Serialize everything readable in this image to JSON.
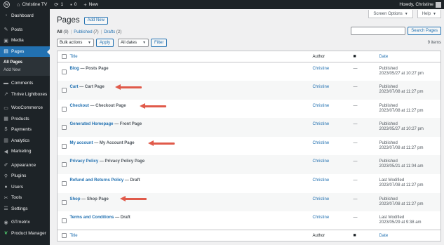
{
  "admin_bar": {
    "site_name": "Christine TV",
    "updates_count": "1",
    "comments_count": "0",
    "new_label": "New",
    "howdy": "Howdy, Christine"
  },
  "sidebar": {
    "items": [
      {
        "label": "Dashboard",
        "icon": "dashboard-icon"
      },
      {
        "label": "Posts",
        "icon": "pin-icon"
      },
      {
        "label": "Media",
        "icon": "media-icon"
      },
      {
        "label": "Pages",
        "icon": "page-icon"
      },
      {
        "label": "Comments",
        "icon": "comment-icon"
      },
      {
        "label": "Thrive Lightboxes",
        "icon": "thrive-icon"
      },
      {
        "label": "WooCommerce",
        "icon": "woo-icon"
      },
      {
        "label": "Products",
        "icon": "products-icon"
      },
      {
        "label": "Payments",
        "icon": "payments-icon"
      },
      {
        "label": "Analytics",
        "icon": "analytics-icon"
      },
      {
        "label": "Marketing",
        "icon": "megaphone-icon"
      },
      {
        "label": "Appearance",
        "icon": "brush-icon"
      },
      {
        "label": "Plugins",
        "icon": "plugin-icon"
      },
      {
        "label": "Users",
        "icon": "users-icon"
      },
      {
        "label": "Tools",
        "icon": "wrench-icon"
      },
      {
        "label": "Settings",
        "icon": "settings-icon"
      },
      {
        "label": "GTmetrix",
        "icon": "gtmetrix-icon"
      },
      {
        "label": "Product Manager",
        "icon": "leaf-icon"
      }
    ],
    "submenu": [
      "All Pages",
      "Add New"
    ]
  },
  "screen_options_label": "Screen Options",
  "help_label": "Help",
  "page_title": "Pages",
  "add_new_label": "Add New",
  "filters": {
    "all_label": "All",
    "all_count": "(9)",
    "published_label": "Published",
    "published_count": "(7)",
    "drafts_label": "Drafts",
    "drafts_count": "(2)"
  },
  "search": {
    "button_label": "Search Pages",
    "value": ""
  },
  "tablenav": {
    "bulk_actions": "Bulk actions",
    "apply_label": "Apply",
    "all_dates": "All dates",
    "filter_label": "Filter",
    "items_count": "9 items"
  },
  "table": {
    "headers": {
      "title": "Title",
      "author": "Author",
      "date": "Date"
    },
    "rows": [
      {
        "title": "Blog",
        "state": "— Posts Page",
        "author": "Christine",
        "comments": "—",
        "status": "Published",
        "date": "2023/05/27 at 10:27 pm"
      },
      {
        "title": "Cart",
        "state": "— Cart Page",
        "author": "Christine",
        "comments": "—",
        "status": "Published",
        "date": "2023/07/08 at 11:27 pm"
      },
      {
        "title": "Checkout",
        "state": "— Checkout Page",
        "author": "Christine",
        "comments": "—",
        "status": "Published",
        "date": "2023/07/08 at 11:27 pm"
      },
      {
        "title": "Generated Homepage",
        "state": "— Front Page",
        "author": "Christine",
        "comments": "—",
        "status": "Published",
        "date": "2023/05/27 at 10:27 pm"
      },
      {
        "title": "My account",
        "state": "— My Account Page",
        "author": "Christine",
        "comments": "—",
        "status": "Published",
        "date": "2023/07/08 at 11:27 pm"
      },
      {
        "title": "Privacy Policy",
        "state": "— Privacy Policy Page",
        "author": "Christine",
        "comments": "—",
        "status": "Published",
        "date": "2023/05/21 at 11:04 am"
      },
      {
        "title": "Refund and Returns Policy",
        "state": "— Draft",
        "author": "Christine",
        "comments": "—",
        "status": "Last Modified",
        "date": "2023/07/08 at 11:27 pm"
      },
      {
        "title": "Shop",
        "state": "— Shop Page",
        "author": "Christine",
        "comments": "—",
        "status": "Published",
        "date": "2023/07/08 at 11:27 pm"
      },
      {
        "title": "Terms and Conditions",
        "state": "— Draft",
        "author": "Christine",
        "comments": "—",
        "status": "Last Modified",
        "date": "2023/05/29 at 9:38 am"
      }
    ]
  },
  "colors": {
    "admin_dark": "#1d2327",
    "accent_blue": "#2271b1",
    "annotation_arrow": "#e05a4a"
  }
}
